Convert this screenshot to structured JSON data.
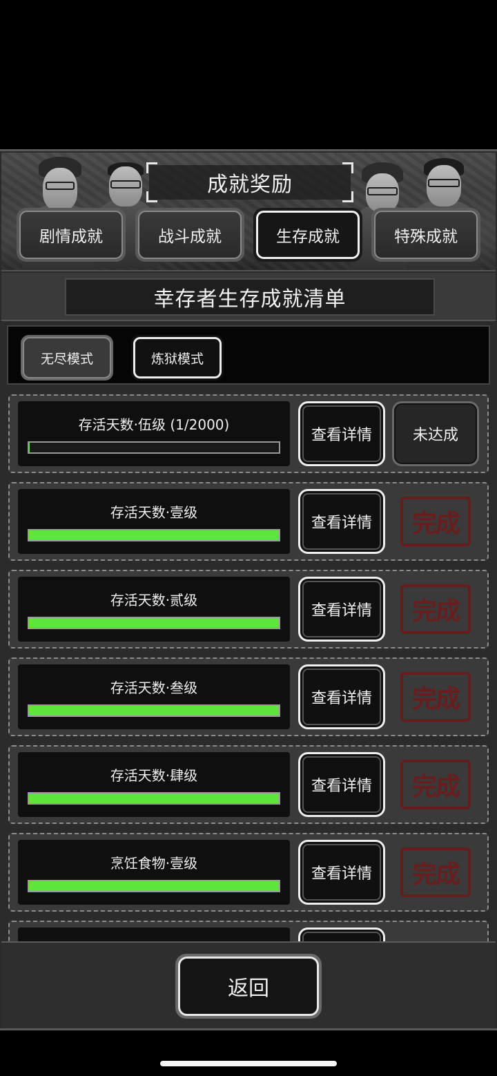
{
  "header": {
    "title": "成就奖励"
  },
  "tabs": [
    {
      "label": "剧情成就",
      "active": false
    },
    {
      "label": "战斗成就",
      "active": false
    },
    {
      "label": "生存成就",
      "active": true
    },
    {
      "label": "特殊成就",
      "active": false
    }
  ],
  "list_title": "幸存者生存成就清单",
  "modes": [
    {
      "label": "无尽模式",
      "active": false
    },
    {
      "label": "炼狱模式",
      "active": true
    }
  ],
  "achievements": [
    {
      "name": "存活天数·伍级 (1/2000)",
      "progress": 0.0005,
      "detail_label": "查看详情",
      "status": "pending",
      "status_label": "未达成"
    },
    {
      "name": "存活天数·壹级",
      "progress": 1.0,
      "detail_label": "查看详情",
      "status": "done",
      "status_label": "完成"
    },
    {
      "name": "存活天数·贰级",
      "progress": 1.0,
      "detail_label": "查看详情",
      "status": "done",
      "status_label": "完成"
    },
    {
      "name": "存活天数·叁级",
      "progress": 1.0,
      "detail_label": "查看详情",
      "status": "done",
      "status_label": "完成"
    },
    {
      "name": "存活天数·肆级",
      "progress": 1.0,
      "detail_label": "查看详情",
      "status": "done",
      "status_label": "完成"
    },
    {
      "name": "烹饪食物·壹级",
      "progress": 1.0,
      "detail_label": "查看详情",
      "status": "done",
      "status_label": "完成"
    },
    {
      "name": "",
      "progress": 1.0,
      "detail_label": "",
      "status": "done",
      "status_label": ""
    }
  ],
  "footer": {
    "back_label": "返回"
  },
  "colors": {
    "progress_fill": "#5ee43a",
    "stamp": "#6e1c1c",
    "panel": "#2b2b2b"
  }
}
